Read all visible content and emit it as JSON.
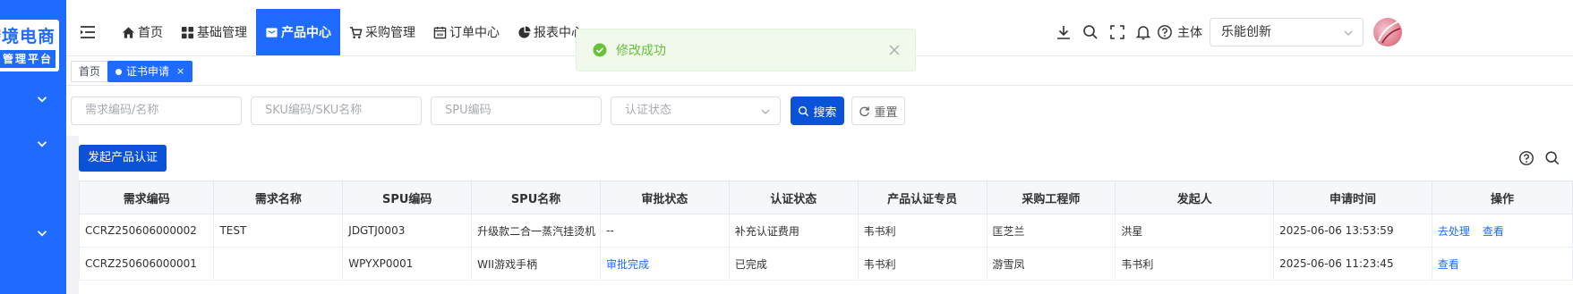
{
  "brand": {
    "logo_line1": "跨境电商",
    "logo_line2": "管理平台"
  },
  "nav": {
    "items": [
      {
        "label": "首页",
        "icon": "home-icon",
        "active": false
      },
      {
        "label": "基础管理",
        "icon": "grid-icon",
        "active": false
      },
      {
        "label": "产品中心",
        "icon": "box-icon",
        "active": true
      },
      {
        "label": "采购管理",
        "icon": "cart-icon",
        "active": false
      },
      {
        "label": "订单中心",
        "icon": "calendar-icon",
        "active": false
      },
      {
        "label": "报表中心",
        "icon": "pie-chart-icon",
        "active": false
      }
    ]
  },
  "header": {
    "subject_label": "主体",
    "org_select_value": "乐能创新",
    "icons": [
      "download-icon",
      "search-icon",
      "fullscreen-icon",
      "bell-icon",
      "help-icon"
    ]
  },
  "toast": {
    "message": "修改成功",
    "type": "success"
  },
  "tags": [
    {
      "label": "首页",
      "active": false
    },
    {
      "label": "证书申请",
      "active": true,
      "close": "×"
    }
  ],
  "filters": {
    "demand_placeholder": "需求编码/名称",
    "sku_placeholder": "SKU编码/SKU名称",
    "spu_placeholder": "SPU编码",
    "status_placeholder": "认证状态",
    "search_label": "搜索",
    "reset_label": "重置"
  },
  "toolbar": {
    "launch_label": "发起产品认证"
  },
  "table": {
    "columns": [
      "需求编码",
      "需求名称",
      "SPU编码",
      "SPU名称",
      "审批状态",
      "认证状态",
      "产品认证专员",
      "采购工程师",
      "发起人",
      "申请时间",
      "操作"
    ],
    "rows": [
      {
        "demand_code": "CCRZ250606000002",
        "demand_name": "TEST",
        "spu_code": "JDGTJ0003",
        "spu_name": "升级款二合一蒸汽挂烫机",
        "approval_status": "--",
        "cert_status": "补充认证费用",
        "cert_specialist": "韦书利",
        "purchase_engineer": "匡芝兰",
        "initiator": "洪星",
        "apply_time": "2025-06-06 13:53:59",
        "actions": [
          "去处理",
          "查看"
        ]
      },
      {
        "demand_code": "CCRZ250606000001",
        "demand_name": "",
        "spu_code": "WPYXP0001",
        "spu_name": "WII游戏手柄",
        "approval_status": "审批完成",
        "cert_status": "已完成",
        "cert_specialist": "韦书利",
        "purchase_engineer": "游雪凤",
        "initiator": "韦书利",
        "apply_time": "2025-06-06 11:23:45",
        "actions": [
          "查看"
        ]
      }
    ]
  },
  "colors": {
    "primary": "#1f6bff",
    "primary_dark": "#0a53d9",
    "success": "#67c23a"
  }
}
